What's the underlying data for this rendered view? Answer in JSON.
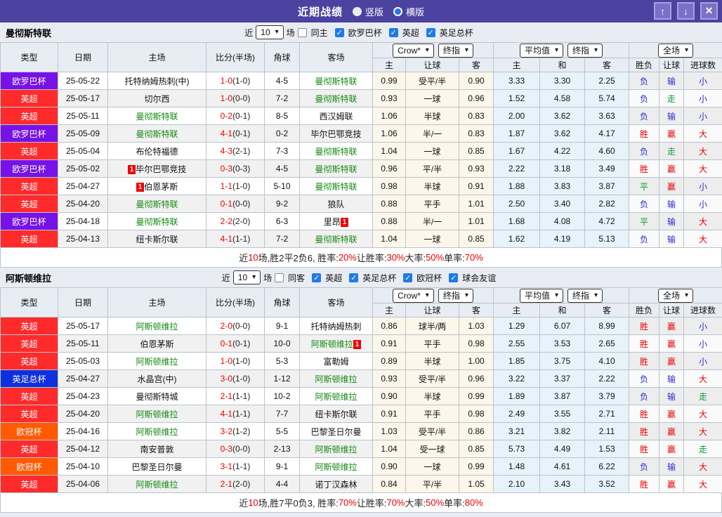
{
  "titlebar": {
    "title": "近期战绩",
    "radios": [
      {
        "label": "竖版",
        "selected": false
      },
      {
        "label": "横版",
        "selected": true
      }
    ]
  },
  "icons": {
    "up": "↑",
    "down": "↓",
    "close": "✕",
    "dropdown_arrow": "▾",
    "check": "✓"
  },
  "table_header": {
    "cols": [
      "类型",
      "日期",
      "主场",
      "比分(半场)",
      "角球",
      "客场"
    ],
    "group1": {
      "dd1": "Crow*",
      "dd2": "终指",
      "sub": [
        "主",
        "让球",
        "客"
      ]
    },
    "group2": {
      "dd1": "平均值",
      "dd2": "终指",
      "sub": [
        "主",
        "和",
        "客"
      ]
    },
    "group3": {
      "dd": "全场",
      "sub": [
        "胜负",
        "让球",
        "进球数"
      ]
    }
  },
  "type_colors": {
    "欧罗巴杯": "#7712e6",
    "英超": "#ff2b2b",
    "英足总杯": "#0d2fe0",
    "欧冠杯": "#ff5a00"
  },
  "result_colors": {
    "r": "#e60000",
    "b": "#2b2bd5",
    "g": "#0a9a3c"
  },
  "sections": [
    {
      "team": "曼彻斯特联",
      "filter": {
        "prefix": "近",
        "count": "10",
        "suffix": "场",
        "same": {
          "label": "同主",
          "checked": false
        },
        "leagues": [
          {
            "label": "欧罗巴杯",
            "checked": true
          },
          {
            "label": "英超",
            "checked": true
          },
          {
            "label": "英足总杯",
            "checked": true
          }
        ]
      },
      "rows": [
        {
          "type": "欧罗巴杯",
          "date": "25-05-22",
          "home": {
            "name": "托特纳姆热刺(中)",
            "green": false
          },
          "score": "1-0",
          "half": "(1-0)",
          "corner": "4-5",
          "away": {
            "name": "曼彻斯特联",
            "green": true
          },
          "odds": [
            "0.99",
            "受平/半",
            "0.90"
          ],
          "avg": [
            "3.33",
            "3.30",
            "2.25"
          ],
          "res": [
            [
              "负",
              "b"
            ],
            [
              "输",
              "b"
            ],
            [
              "小",
              "b"
            ]
          ]
        },
        {
          "type": "英超",
          "date": "25-05-17",
          "home": {
            "name": "切尔西",
            "green": false
          },
          "score": "1-0",
          "half": "(0-0)",
          "corner": "7-2",
          "away": {
            "name": "曼彻斯特联",
            "green": true
          },
          "odds": [
            "0.93",
            "一球",
            "0.96"
          ],
          "avg": [
            "1.52",
            "4.58",
            "5.74"
          ],
          "res": [
            [
              "负",
              "b"
            ],
            [
              "走",
              "g"
            ],
            [
              "小",
              "b"
            ]
          ]
        },
        {
          "type": "英超",
          "date": "25-05-11",
          "home": {
            "name": "曼彻斯特联",
            "green": true
          },
          "score": "0-2",
          "half": "(0-1)",
          "corner": "8-5",
          "away": {
            "name": "西汉姆联",
            "green": false
          },
          "odds": [
            "1.06",
            "半球",
            "0.83"
          ],
          "avg": [
            "2.00",
            "3.62",
            "3.63"
          ],
          "res": [
            [
              "负",
              "b"
            ],
            [
              "输",
              "b"
            ],
            [
              "小",
              "b"
            ]
          ]
        },
        {
          "type": "欧罗巴杯",
          "date": "25-05-09",
          "home": {
            "name": "曼彻斯特联",
            "green": true
          },
          "score": "4-1",
          "half": "(0-1)",
          "corner": "0-2",
          "away": {
            "name": "毕尔巴鄂竞技",
            "green": false
          },
          "odds": [
            "1.06",
            "半/一",
            "0.83"
          ],
          "avg": [
            "1.87",
            "3.62",
            "4.17"
          ],
          "res": [
            [
              "胜",
              "r"
            ],
            [
              "赢",
              "r"
            ],
            [
              "大",
              "r"
            ]
          ]
        },
        {
          "type": "英超",
          "date": "25-05-04",
          "home": {
            "name": "布伦特福德",
            "green": false
          },
          "score": "4-3",
          "half": "(2-1)",
          "corner": "7-3",
          "away": {
            "name": "曼彻斯特联",
            "green": true
          },
          "odds": [
            "1.04",
            "一球",
            "0.85"
          ],
          "avg": [
            "1.67",
            "4.22",
            "4.60"
          ],
          "res": [
            [
              "负",
              "b"
            ],
            [
              "走",
              "g"
            ],
            [
              "大",
              "r"
            ]
          ]
        },
        {
          "type": "欧罗巴杯",
          "date": "25-05-02",
          "home": {
            "name": "毕尔巴鄂竞技",
            "green": false,
            "badge": "1",
            "badge_pos": "before"
          },
          "score": "0-3",
          "half": "(0-3)",
          "corner": "4-5",
          "away": {
            "name": "曼彻斯特联",
            "green": true
          },
          "odds": [
            "0.96",
            "平/半",
            "0.93"
          ],
          "avg": [
            "2.22",
            "3.18",
            "3.49"
          ],
          "res": [
            [
              "胜",
              "r"
            ],
            [
              "赢",
              "r"
            ],
            [
              "大",
              "r"
            ]
          ]
        },
        {
          "type": "英超",
          "date": "25-04-27",
          "home": {
            "name": "伯恩茅斯",
            "green": false,
            "badge": "1",
            "badge_pos": "before"
          },
          "score": "1-1",
          "half": "(1-0)",
          "corner": "5-10",
          "away": {
            "name": "曼彻斯特联",
            "green": true
          },
          "odds": [
            "0.98",
            "半球",
            "0.91"
          ],
          "avg": [
            "1.88",
            "3.83",
            "3.87"
          ],
          "res": [
            [
              "平",
              "g"
            ],
            [
              "赢",
              "r"
            ],
            [
              "小",
              "b"
            ]
          ]
        },
        {
          "type": "英超",
          "date": "25-04-20",
          "home": {
            "name": "曼彻斯特联",
            "green": true
          },
          "score": "0-1",
          "half": "(0-0)",
          "corner": "9-2",
          "away": {
            "name": "狼队",
            "green": false
          },
          "odds": [
            "0.88",
            "平手",
            "1.01"
          ],
          "avg": [
            "2.50",
            "3.40",
            "2.82"
          ],
          "res": [
            [
              "负",
              "b"
            ],
            [
              "输",
              "b"
            ],
            [
              "小",
              "b"
            ]
          ]
        },
        {
          "type": "欧罗巴杯",
          "date": "25-04-18",
          "home": {
            "name": "曼彻斯特联",
            "green": true
          },
          "score": "2-2",
          "half": "(2-0)",
          "corner": "6-3",
          "away": {
            "name": "里昂",
            "green": false,
            "badge": "1",
            "badge_pos": "after"
          },
          "odds": [
            "0.88",
            "半/一",
            "1.01"
          ],
          "avg": [
            "1.68",
            "4.08",
            "4.72"
          ],
          "res": [
            [
              "平",
              "g"
            ],
            [
              "输",
              "b"
            ],
            [
              "大",
              "r"
            ]
          ]
        },
        {
          "type": "英超",
          "date": "25-04-13",
          "home": {
            "name": "纽卡斯尔联",
            "green": false
          },
          "score": "4-1",
          "half": "(1-1)",
          "corner": "7-2",
          "away": {
            "name": "曼彻斯特联",
            "green": true
          },
          "odds": [
            "1.04",
            "一球",
            "0.85"
          ],
          "avg": [
            "1.62",
            "4.19",
            "5.13"
          ],
          "res": [
            [
              "负",
              "b"
            ],
            [
              "输",
              "b"
            ],
            [
              "大",
              "r"
            ]
          ]
        }
      ],
      "summary": [
        [
          "近",
          "k"
        ],
        [
          "10",
          "r"
        ],
        [
          "场,胜2平2负6, 胜率:",
          "k"
        ],
        [
          "20%",
          "r"
        ],
        [
          " 让胜率:",
          "k"
        ],
        [
          "30%",
          "r"
        ],
        [
          " 大率:",
          "k"
        ],
        [
          "50%",
          "r"
        ],
        [
          " 单率:",
          "k"
        ],
        [
          "70%",
          "r"
        ]
      ]
    },
    {
      "team": "阿斯顿维拉",
      "filter": {
        "prefix": "近",
        "count": "10",
        "suffix": "场",
        "same": {
          "label": "同客",
          "checked": false
        },
        "leagues": [
          {
            "label": "英超",
            "checked": true
          },
          {
            "label": "英足总杯",
            "checked": true
          },
          {
            "label": "欧冠杯",
            "checked": true
          },
          {
            "label": "球会友谊",
            "checked": true
          }
        ]
      },
      "rows": [
        {
          "type": "英超",
          "date": "25-05-17",
          "home": {
            "name": "阿斯顿维拉",
            "green": true
          },
          "score": "2-0",
          "half": "(0-0)",
          "corner": "9-1",
          "away": {
            "name": "托特纳姆热刺",
            "green": false
          },
          "odds": [
            "0.86",
            "球半/两",
            "1.03"
          ],
          "avg": [
            "1.29",
            "6.07",
            "8.99"
          ],
          "res": [
            [
              "胜",
              "r"
            ],
            [
              "赢",
              "r"
            ],
            [
              "小",
              "b"
            ]
          ]
        },
        {
          "type": "英超",
          "date": "25-05-11",
          "home": {
            "name": "伯恩茅斯",
            "green": false
          },
          "score": "0-1",
          "half": "(0-1)",
          "corner": "10-0",
          "away": {
            "name": "阿斯顿维拉",
            "green": true,
            "badge": "1",
            "badge_pos": "after"
          },
          "odds": [
            "0.91",
            "平手",
            "0.98"
          ],
          "avg": [
            "2.55",
            "3.53",
            "2.65"
          ],
          "res": [
            [
              "胜",
              "r"
            ],
            [
              "赢",
              "r"
            ],
            [
              "小",
              "b"
            ]
          ]
        },
        {
          "type": "英超",
          "date": "25-05-03",
          "home": {
            "name": "阿斯顿维拉",
            "green": true
          },
          "score": "1-0",
          "half": "(1-0)",
          "corner": "5-3",
          "away": {
            "name": "富勒姆",
            "green": false
          },
          "odds": [
            "0.89",
            "半球",
            "1.00"
          ],
          "avg": [
            "1.85",
            "3.75",
            "4.10"
          ],
          "res": [
            [
              "胜",
              "r"
            ],
            [
              "赢",
              "r"
            ],
            [
              "小",
              "b"
            ]
          ]
        },
        {
          "type": "英足总杯",
          "date": "25-04-27",
          "home": {
            "name": "水晶宫(中)",
            "green": false
          },
          "score": "3-0",
          "half": "(1-0)",
          "corner": "1-12",
          "away": {
            "name": "阿斯顿维拉",
            "green": true
          },
          "odds": [
            "0.93",
            "受平/半",
            "0.96"
          ],
          "avg": [
            "3.22",
            "3.37",
            "2.22"
          ],
          "res": [
            [
              "负",
              "b"
            ],
            [
              "输",
              "b"
            ],
            [
              "大",
              "r"
            ]
          ]
        },
        {
          "type": "英超",
          "date": "25-04-23",
          "home": {
            "name": "曼彻斯特城",
            "green": false
          },
          "score": "2-1",
          "half": "(1-1)",
          "corner": "10-2",
          "away": {
            "name": "阿斯顿维拉",
            "green": true
          },
          "odds": [
            "0.90",
            "半球",
            "0.99"
          ],
          "avg": [
            "1.89",
            "3.87",
            "3.79"
          ],
          "res": [
            [
              "负",
              "b"
            ],
            [
              "输",
              "b"
            ],
            [
              "走",
              "g"
            ]
          ]
        },
        {
          "type": "英超",
          "date": "25-04-20",
          "home": {
            "name": "阿斯顿维拉",
            "green": true
          },
          "score": "4-1",
          "half": "(1-1)",
          "corner": "7-7",
          "away": {
            "name": "纽卡斯尔联",
            "green": false
          },
          "odds": [
            "0.91",
            "平手",
            "0.98"
          ],
          "avg": [
            "2.49",
            "3.55",
            "2.71"
          ],
          "res": [
            [
              "胜",
              "r"
            ],
            [
              "赢",
              "r"
            ],
            [
              "大",
              "r"
            ]
          ]
        },
        {
          "type": "欧冠杯",
          "date": "25-04-16",
          "home": {
            "name": "阿斯顿维拉",
            "green": true
          },
          "score": "3-2",
          "half": "(1-2)",
          "corner": "5-5",
          "away": {
            "name": "巴黎圣日尔曼",
            "green": false
          },
          "odds": [
            "1.03",
            "受平/半",
            "0.86"
          ],
          "avg": [
            "3.21",
            "3.82",
            "2.11"
          ],
          "res": [
            [
              "胜",
              "r"
            ],
            [
              "赢",
              "r"
            ],
            [
              "大",
              "r"
            ]
          ]
        },
        {
          "type": "英超",
          "date": "25-04-12",
          "home": {
            "name": "南安普敦",
            "green": false
          },
          "score": "0-3",
          "half": "(0-0)",
          "corner": "2-13",
          "away": {
            "name": "阿斯顿维拉",
            "green": true
          },
          "odds": [
            "1.04",
            "受一球",
            "0.85"
          ],
          "avg": [
            "5.73",
            "4.49",
            "1.53"
          ],
          "res": [
            [
              "胜",
              "r"
            ],
            [
              "赢",
              "r"
            ],
            [
              "走",
              "g"
            ]
          ]
        },
        {
          "type": "欧冠杯",
          "date": "25-04-10",
          "home": {
            "name": "巴黎圣日尔曼",
            "green": false
          },
          "score": "3-1",
          "half": "(1-1)",
          "corner": "9-1",
          "away": {
            "name": "阿斯顿维拉",
            "green": true
          },
          "odds": [
            "0.90",
            "一球",
            "0.99"
          ],
          "avg": [
            "1.48",
            "4.61",
            "6.22"
          ],
          "res": [
            [
              "负",
              "b"
            ],
            [
              "输",
              "b"
            ],
            [
              "大",
              "r"
            ]
          ]
        },
        {
          "type": "英超",
          "date": "25-04-06",
          "home": {
            "name": "阿斯顿维拉",
            "green": true
          },
          "score": "2-1",
          "half": "(2-0)",
          "corner": "4-4",
          "away": {
            "name": "诺丁汉森林",
            "green": false
          },
          "odds": [
            "0.84",
            "平/半",
            "1.05"
          ],
          "avg": [
            "2.10",
            "3.43",
            "3.52"
          ],
          "res": [
            [
              "胜",
              "r"
            ],
            [
              "赢",
              "r"
            ],
            [
              "大",
              "r"
            ]
          ]
        }
      ],
      "summary": [
        [
          "近",
          "k"
        ],
        [
          "10",
          "r"
        ],
        [
          "场,胜7平0负3, 胜率:",
          "k"
        ],
        [
          "70%",
          "r"
        ],
        [
          " 让胜率:",
          "k"
        ],
        [
          "70%",
          "r"
        ],
        [
          " 大率:",
          "k"
        ],
        [
          "50%",
          "r"
        ],
        [
          " 单率:",
          "k"
        ],
        [
          "80%",
          "r"
        ]
      ]
    }
  ]
}
